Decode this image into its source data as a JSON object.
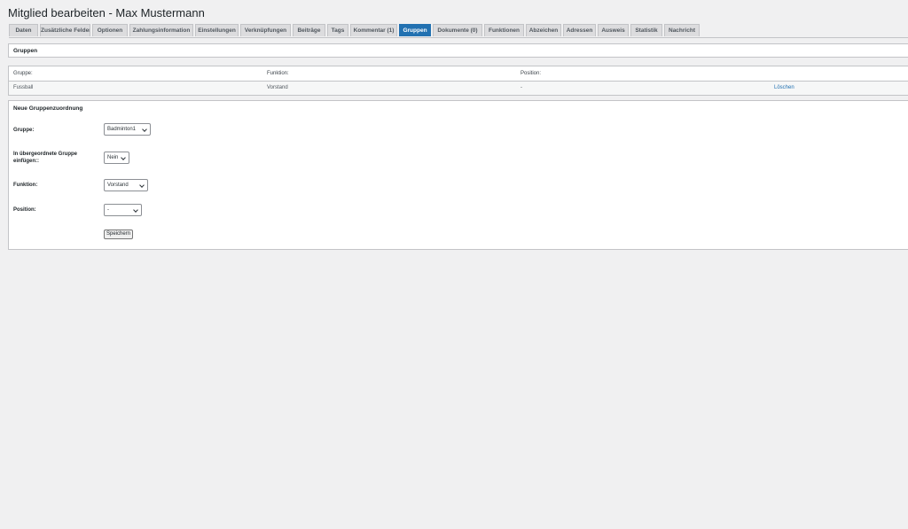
{
  "page": {
    "title": "Mitglied bearbeiten - Max Mustermann"
  },
  "tabs": [
    {
      "label": "Daten"
    },
    {
      "label": "Zusätzliche Felder"
    },
    {
      "label": "Optionen"
    },
    {
      "label": "Zahlungsinformation"
    },
    {
      "label": "Einstellungen"
    },
    {
      "label": "Verknüpfungen"
    },
    {
      "label": "Beiträge"
    },
    {
      "label": "Tags"
    },
    {
      "label": "Kommentar (1)"
    },
    {
      "label": "Gruppen"
    },
    {
      "label": "Dokumente (0)"
    },
    {
      "label": "Funktionen"
    },
    {
      "label": "Abzeichen"
    },
    {
      "label": "Adressen"
    },
    {
      "label": "Ausweis"
    },
    {
      "label": "Statistik"
    },
    {
      "label": "Nachricht"
    }
  ],
  "active_tab": "Gruppen",
  "groups_section": {
    "title": "Gruppen"
  },
  "groups_table": {
    "headers": [
      "Gruppe:",
      "Funktion:",
      "Position:"
    ],
    "rows": [
      {
        "gruppe": "Fussball",
        "funktion": "Vorstand",
        "position": "-",
        "action": "Löschen"
      }
    ]
  },
  "new_assignment": {
    "title": "Neue Gruppenzuordnung",
    "gruppe_label": "Gruppe:",
    "gruppe_value": "Badminton1",
    "parent_label_line1": "In übergeordnete Gruppe",
    "parent_label_line2": "einfügen::",
    "parent_value": "Nein",
    "funktion_label": "Funktion:",
    "funktion_value": "Vorstand",
    "position_label": "Position:",
    "position_value": "-",
    "save_label": "Speichern"
  },
  "colors": {
    "accent": "#2271b1",
    "background": "#f0f0f1",
    "tab_inactive": "#dcdcde"
  }
}
